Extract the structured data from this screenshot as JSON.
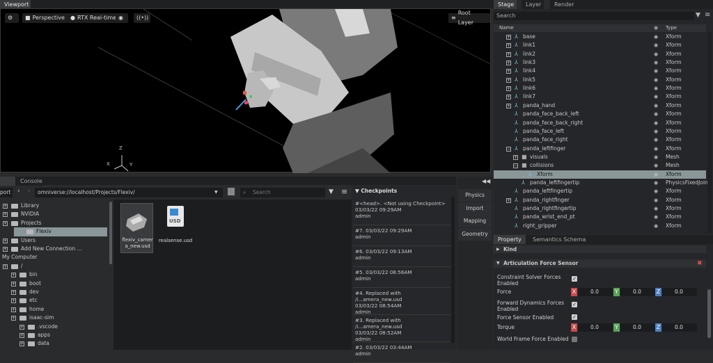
{
  "top_tabs": {
    "viewport": "Viewport",
    "stage": "Stage",
    "layer": "Layer",
    "render_settings": "Render Settings"
  },
  "viewport": {
    "perspective": "Perspective",
    "render_mode": "RTX Real-time",
    "root_layer": "Root Layer",
    "axes": {
      "z": "Z",
      "x": "X",
      "y": "Y"
    }
  },
  "stage": {
    "search_placeholder": "Search",
    "col_name": "Name",
    "col_type": "Type",
    "rows": [
      {
        "name": "base",
        "type": "Xform",
        "indent": 1,
        "expander": "+"
      },
      {
        "name": "link1",
        "type": "Xform",
        "indent": 1,
        "expander": "+"
      },
      {
        "name": "link2",
        "type": "Xform",
        "indent": 1,
        "expander": "+"
      },
      {
        "name": "link3",
        "type": "Xform",
        "indent": 1,
        "expander": "+"
      },
      {
        "name": "link4",
        "type": "Xform",
        "indent": 1,
        "expander": "+"
      },
      {
        "name": "link5",
        "type": "Xform",
        "indent": 1,
        "expander": "+"
      },
      {
        "name": "link6",
        "type": "Xform",
        "indent": 1,
        "expander": "+"
      },
      {
        "name": "link7",
        "type": "Xform",
        "indent": 1,
        "expander": "+"
      },
      {
        "name": "panda_hand",
        "type": "Xform",
        "indent": 1,
        "expander": "+"
      },
      {
        "name": "panda_face_back_left",
        "type": "Xform",
        "indent": 1,
        "expander": ""
      },
      {
        "name": "panda_face_back_right",
        "type": "Xform",
        "indent": 1,
        "expander": ""
      },
      {
        "name": "panda_face_left",
        "type": "Xform",
        "indent": 1,
        "expander": ""
      },
      {
        "name": "panda_face_right",
        "type": "Xform",
        "indent": 1,
        "expander": ""
      },
      {
        "name": "panda_leftfinger",
        "type": "Xform",
        "indent": 1,
        "expander": "−"
      },
      {
        "name": "visuals",
        "type": "Mesh",
        "indent": 2,
        "expander": "+"
      },
      {
        "name": "collisions",
        "type": "Mesh",
        "indent": 2,
        "expander": "−"
      },
      {
        "name": "Xform",
        "type": "Xform",
        "indent": 3,
        "expander": "",
        "selected": true
      },
      {
        "name": "panda_leftfingertip",
        "type": "PhysicsFixedJoin",
        "indent": 2,
        "expander": ""
      },
      {
        "name": "panda_leftfingertip",
        "type": "Xform",
        "indent": 1,
        "expander": ""
      },
      {
        "name": "panda_rightfinger",
        "type": "Xform",
        "indent": 1,
        "expander": "+"
      },
      {
        "name": "panda_rightfingertip",
        "type": "Xform",
        "indent": 1,
        "expander": ""
      },
      {
        "name": "panda_wrist_end_pt",
        "type": "Xform",
        "indent": 1,
        "expander": ""
      },
      {
        "name": "right_gripper",
        "type": "Xform",
        "indent": 1,
        "expander": ""
      }
    ]
  },
  "property": {
    "tab_property": "Property",
    "tab_semantics": "Semantics Schema Editor",
    "kind": "Kind",
    "section": "Articulation Force Sensor",
    "constraint_solver": "Constraint Solver Forces Enabled",
    "force": "Force",
    "forward_dynamics": "Forward Dynamics Forces Enabled",
    "force_sensor_enabled": "Force Sensor Enabled",
    "torque": "Torque",
    "world_frame": "World Frame Force Enabled",
    "force_x": "0.0",
    "force_y": "0.0",
    "force_z": "0.0",
    "torque_x": "0.0",
    "torque_y": "0.0",
    "torque_z": "0.0",
    "ax_x": "X",
    "ax_y": "Y",
    "ax_z": "Z"
  },
  "content": {
    "tab_content": "Content",
    "tab_console": "Console",
    "import_btn": "port",
    "path": "omniverse://localhost/Projects/Flexiv/",
    "search_placeholder": "Search",
    "tree": [
      {
        "label": "Library",
        "indent": 0
      },
      {
        "label": "NVIDIA",
        "indent": 0
      },
      {
        "label": "Projects",
        "indent": 0
      },
      {
        "label": "Flexiv",
        "indent": 1,
        "selected": true
      },
      {
        "label": "Users",
        "indent": 0
      },
      {
        "label": "Add New Connection ...",
        "indent": 0
      },
      {
        "label": "My Computer",
        "indent": -1
      },
      {
        "label": "/",
        "indent": 0
      },
      {
        "label": "bin",
        "indent": 1
      },
      {
        "label": "boot",
        "indent": 1
      },
      {
        "label": "dev",
        "indent": 1
      },
      {
        "label": "etc",
        "indent": 1
      },
      {
        "label": "home",
        "indent": 1
      },
      {
        "label": "isaac-sim",
        "indent": 1
      },
      {
        "label": ".vscode",
        "indent": 2
      },
      {
        "label": "apps",
        "indent": 2
      },
      {
        "label": "data",
        "indent": 2
      }
    ],
    "files": [
      {
        "name": "flexiv_camera_new.usd"
      },
      {
        "name": "realsense.usd"
      }
    ],
    "usd_badge": "USD",
    "checkpoints_title": "Checkpoints",
    "checkpoints": [
      {
        "l1": "#<head>.   <Not using Checkpoint>",
        "l2": "03/03/22 09:29AM",
        "l3": "admin"
      },
      {
        "l1": "#7.   03/03/22 09:29AM",
        "l2": "admin",
        "l3": ""
      },
      {
        "l1": "#6.   03/03/22 09:13AM",
        "l2": "admin",
        "l3": ""
      },
      {
        "l1": "#5.   03/03/22 08:56AM",
        "l2": "admin",
        "l3": ""
      },
      {
        "l1": "#4.   Replaced with /i...amera_new.usd",
        "l2": "03/03/22 08:54AM",
        "l3": "admin"
      },
      {
        "l1": "#3.   Replaced with /i...amera_new.usd",
        "l2": "03/03/22 08:52AM",
        "l3": "admin"
      },
      {
        "l1": "#2.   03/03/22 03:44AM",
        "l2": "admin",
        "l3": ""
      }
    ],
    "side": [
      "Physics",
      "Import",
      "Mapping",
      "Geometry"
    ]
  }
}
